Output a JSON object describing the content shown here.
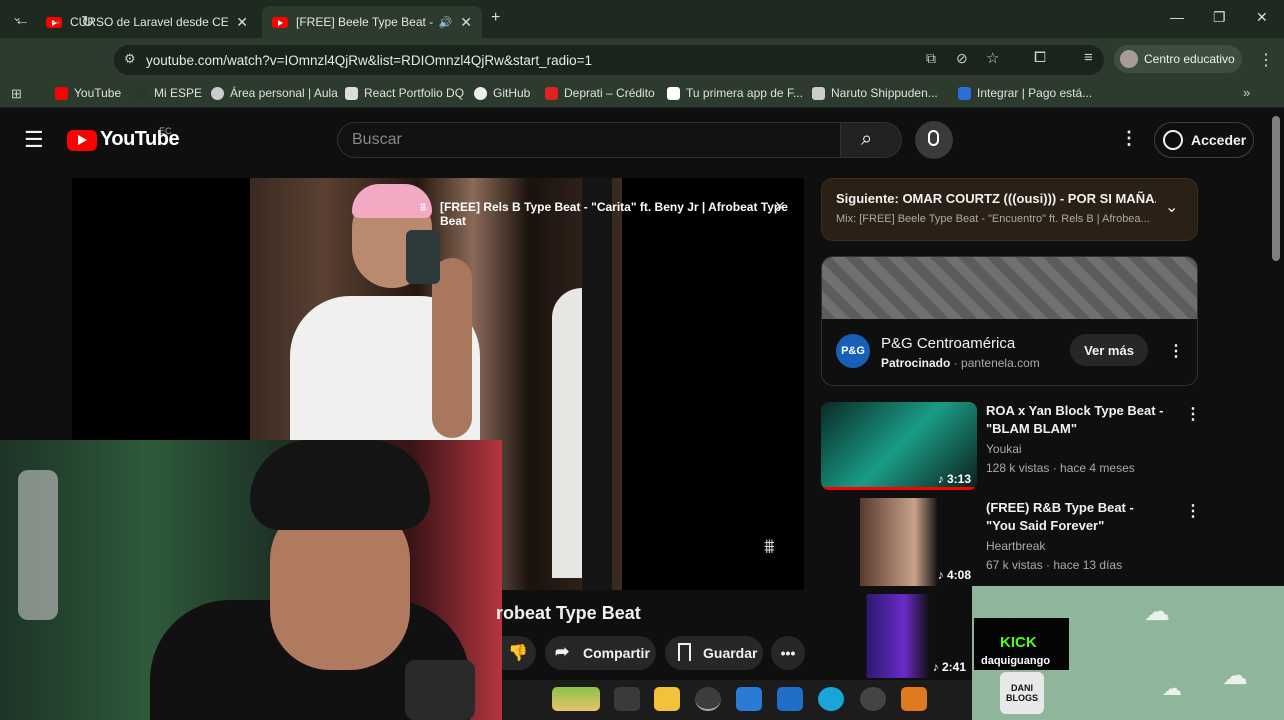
{
  "browser": {
    "tabs": [
      {
        "title": "CURSO de Laravel desde CERO"
      },
      {
        "title": "[FREE] Beele Type Beat - \"En"
      }
    ],
    "url": "youtube.com/watch?v=IOmnzl4QjRw&list=RDIOmnzl4QjRw&start_radio=1",
    "profile": "Centro educativo",
    "bookmarks": [
      "YouTube",
      "Mi ESPE",
      "Área personal | Aula",
      "React Portfolio DQ",
      "GitHub",
      "Deprati – Crédito",
      "Tu primera app de F...",
      "Naruto Shippuden...",
      "Integrar | Pago está..."
    ]
  },
  "youtube": {
    "logo": "YouTube",
    "region": "EC",
    "search_placeholder": "Buscar",
    "signin": "Acceder",
    "player_banner": "[FREE] Rels B Type Beat - \"Carita\" ft. Beny Jr | Afrobeat Type Beat",
    "video_title_fragment": "robeat Type Beat",
    "actions": {
      "share": "Compartir",
      "save": "Guardar"
    },
    "next": {
      "title": "Siguiente: OMAR COURTZ (((ousi))) - POR SI MAÑA...",
      "subtitle": "Mix: [FREE] Beele Type Beat - \"Encuentro\" ft. Rels B | Afrobea..."
    },
    "ad": {
      "logo": "P&G",
      "title": "P&G Centroamérica",
      "sponsored": "Patrocinado",
      "domain": "pantenela.com",
      "cta": "Ver más"
    },
    "recommendations": [
      {
        "title": "ROA x Yan Block Type Beat - \"BLAM BLAM\"",
        "channel": "Youkai",
        "views": "128 k vistas",
        "age": "hace 4 meses",
        "duration": "3:13"
      },
      {
        "title": "(FREE) R&B Type Beat - \"You Said Forever\"",
        "channel": "Heartbreak",
        "views": "67 k vistas",
        "age": "hace 13 días",
        "duration": "4:08"
      },
      {
        "title": "",
        "channel": "",
        "views": "",
        "age": "",
        "duration": "2:41"
      }
    ]
  },
  "stream_overlay": {
    "platform": "KICK",
    "username": "daquiguango",
    "badge": "DANI BLOGS"
  }
}
